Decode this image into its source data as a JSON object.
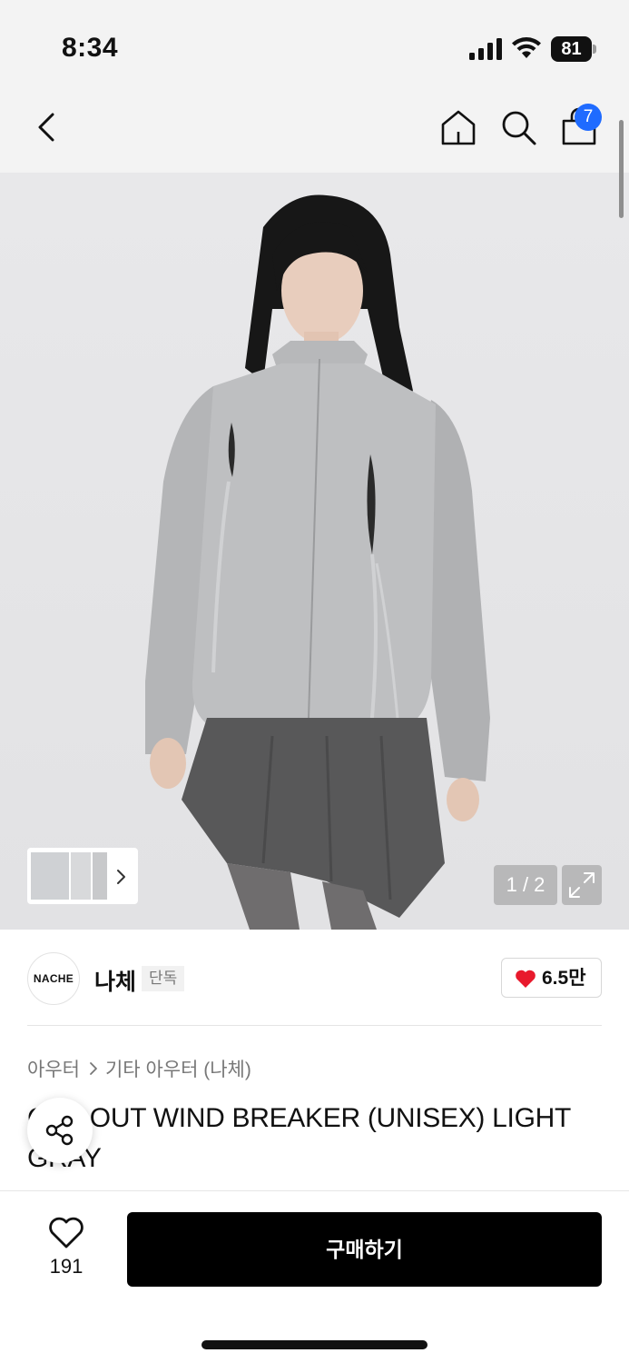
{
  "status_bar": {
    "time": "8:34",
    "battery": "81"
  },
  "header": {
    "back_icon": "chevron-left-icon",
    "home_icon": "home-icon",
    "search_icon": "search-icon",
    "cart_icon": "shopping-bag-icon",
    "cart_badge": "7",
    "badge_color": "#1f6bff"
  },
  "gallery": {
    "counter": "1 / 2",
    "thumbnails_count": 3,
    "expand_icon": "expand-icon"
  },
  "brand": {
    "logo_text": "NACHE",
    "name": "나체",
    "tag": "단독",
    "likes": "6.5만",
    "like_color": "#e8192c"
  },
  "breadcrumb": {
    "category": "아우터",
    "subcategory": "기타 아우터 (나체)"
  },
  "product": {
    "title": "CUT-OUT WIND BREAKER (UNISEX) LIGHT GRAY"
  },
  "bottom_bar": {
    "wish_count": "191",
    "buy_label": "구매하기"
  }
}
